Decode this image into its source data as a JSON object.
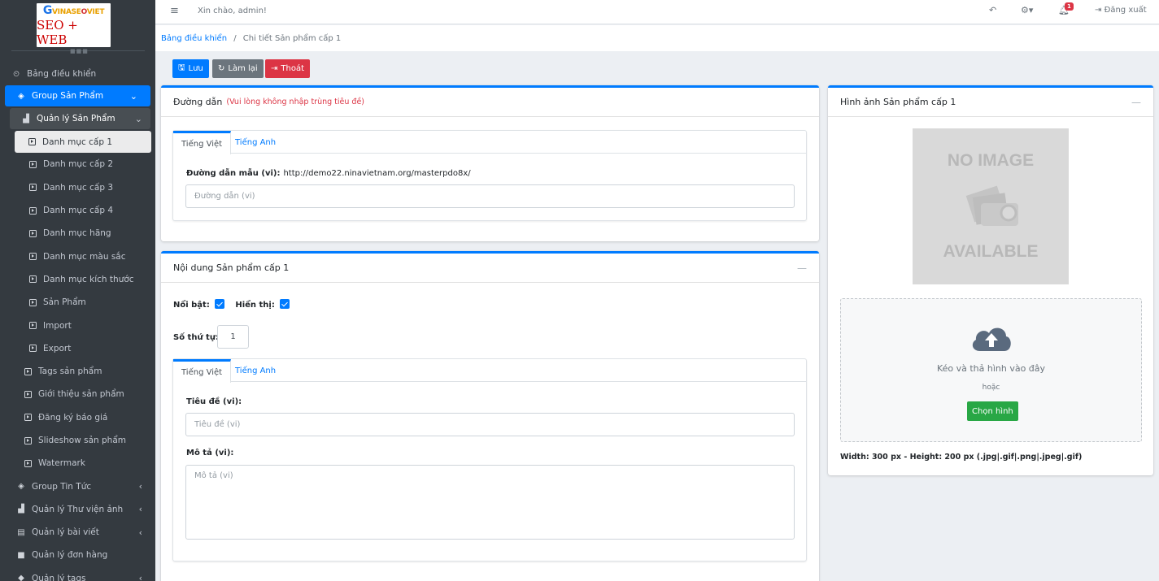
{
  "logo": {
    "brand": "VINASEOVIET",
    "sub": "SEO + WEB"
  },
  "topbar": {
    "greeting": "Xin chào, admin!",
    "notif_count": "1",
    "logout": "Đăng xuất"
  },
  "breadcrumb": {
    "home": "Bảng điều khiển",
    "sep": "/",
    "current": "Chi tiết Sản phẩm cấp 1"
  },
  "actions": {
    "save": "Lưu",
    "reset": "Làm lại",
    "exit": "Thoát"
  },
  "sidebar": {
    "items": [
      {
        "label": "Bảng điều khiển"
      },
      {
        "label": "Group Sản Phẩm"
      },
      {
        "label": "Quản lý Sản Phẩm"
      },
      {
        "label": "Danh mục cấp 1"
      },
      {
        "label": "Danh mục cấp 2"
      },
      {
        "label": "Danh mục cấp 3"
      },
      {
        "label": "Danh mục cấp 4"
      },
      {
        "label": "Danh mục hãng"
      },
      {
        "label": "Danh mục màu sắc"
      },
      {
        "label": "Danh mục kích thước"
      },
      {
        "label": "Sản Phẩm"
      },
      {
        "label": "Import"
      },
      {
        "label": "Export"
      },
      {
        "label": "Tags sản phẩm"
      },
      {
        "label": "Giới thiệu sản phẩm"
      },
      {
        "label": "Đăng ký báo giá"
      },
      {
        "label": "Slideshow sản phẩm"
      },
      {
        "label": "Watermark"
      },
      {
        "label": "Group Tin Tức"
      },
      {
        "label": "Quản lý Thư viện ảnh"
      },
      {
        "label": "Quản lý bài viết"
      },
      {
        "label": "Quản lý đơn hàng"
      },
      {
        "label": "Quản lý tags"
      }
    ]
  },
  "slug_card": {
    "title": "Đường dẫn",
    "note": "(Vui lòng không nhập trùng tiêu đề)",
    "tab_vi": "Tiếng Việt",
    "tab_en": "Tiếng Anh",
    "sample_label": "Đường dẫn mẫu (vi):",
    "sample_value": "http://demo22.ninavietnam.org/masterpdo8x/",
    "input_placeholder": "Đường dẫn (vi)"
  },
  "content_card": {
    "title": "Nội dung Sản phẩm cấp 1",
    "collapse": "—",
    "featured_label": "Nổi bật:",
    "visible_label": "Hiển thị:",
    "order_label": "Số thứ tự:",
    "order_value": "1",
    "tab_vi": "Tiếng Việt",
    "tab_en": "Tiếng Anh",
    "title_label": "Tiêu đề (vi):",
    "title_placeholder": "Tiêu đề (vi)",
    "desc_label": "Mô tả (vi):",
    "desc_placeholder": "Mô tả (vi)"
  },
  "image_card": {
    "title": "Hình ảnh Sản phẩm cấp 1",
    "collapse": "—",
    "noimage_top": "NO IMAGE",
    "noimage_bottom": "AVAILABLE",
    "drop_text": "Kéo và thả hình vào đây",
    "or_text": "hoặc",
    "choose_button": "Chọn hình",
    "hint": "Width: 300 px - Height: 200 px (.jpg|.gif|.png|.jpeg|.gif)"
  }
}
